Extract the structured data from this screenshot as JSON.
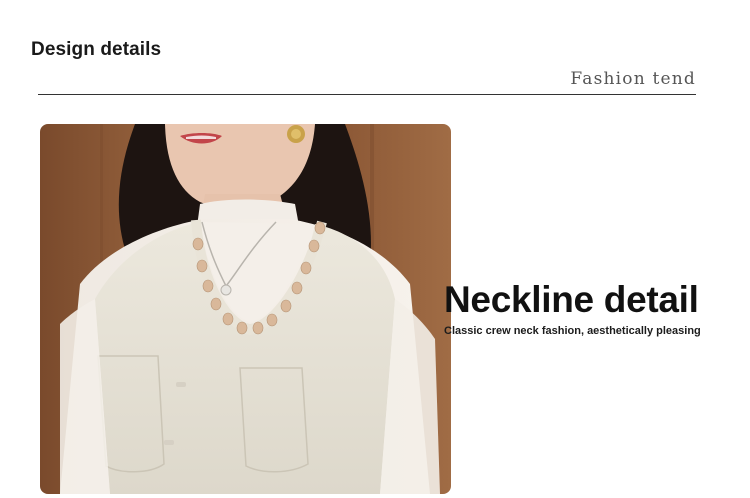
{
  "section": {
    "title": "Design details",
    "subtitle": "Fashion tend"
  },
  "photo": {
    "icon": "product-photo"
  },
  "feature": {
    "title": "Neckline detail",
    "description": "Classic crew neck fashion, aesthetically pleasing"
  },
  "colors": {
    "text": "#1a1a1a",
    "divider": "#333333",
    "background": "#ffffff"
  }
}
